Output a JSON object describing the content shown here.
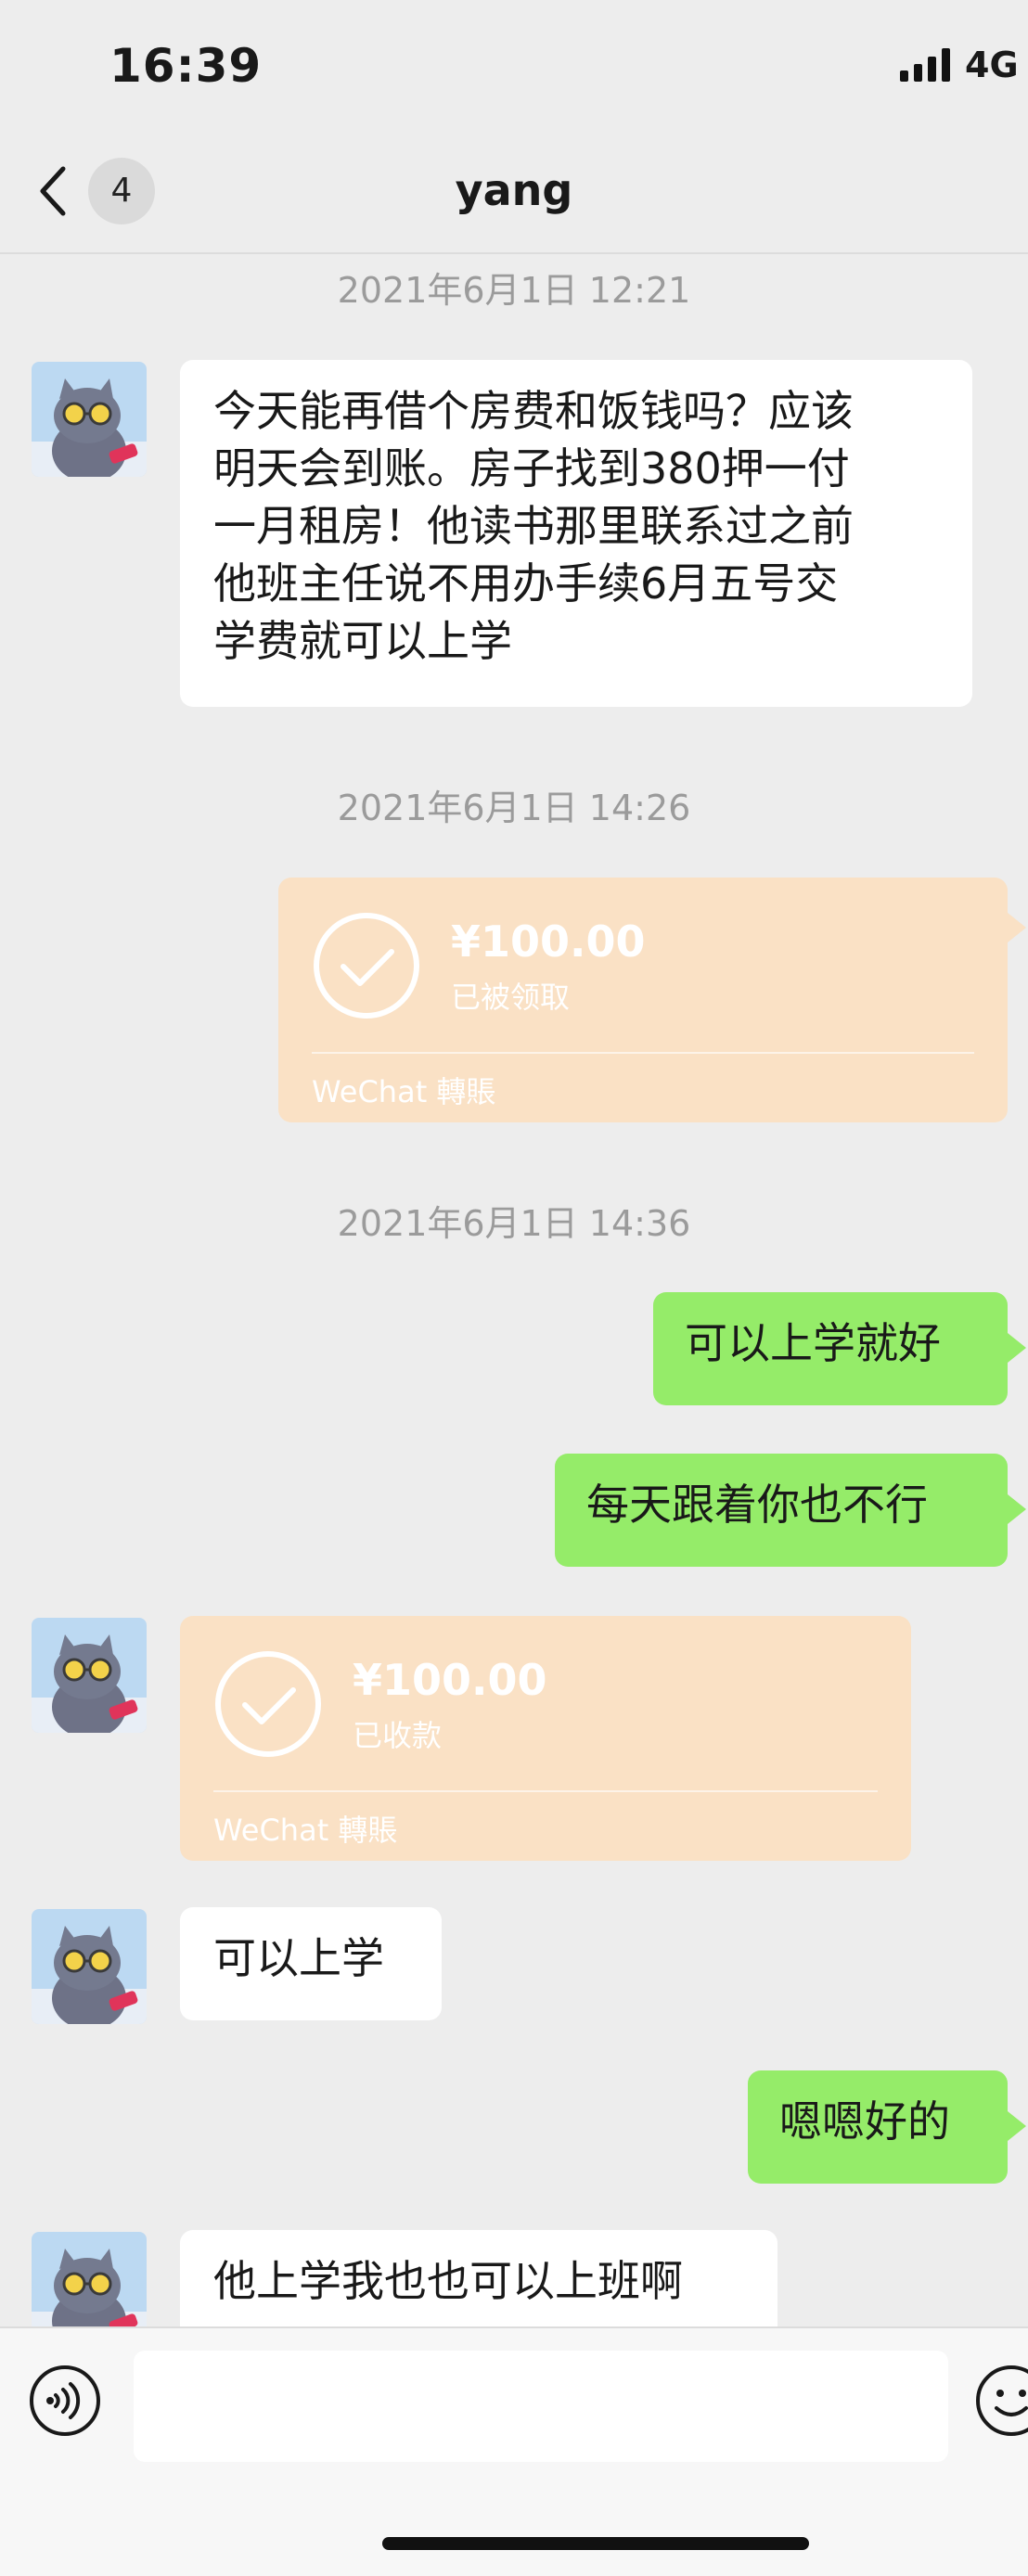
{
  "status_bar": {
    "time": "16:39",
    "network": "4G"
  },
  "nav": {
    "back_count": "4",
    "title": "yang"
  },
  "messages": [
    {
      "type": "timestamp",
      "text": "2021年6月1日 12:21"
    },
    {
      "type": "incoming_text",
      "lines": [
        "今天能再借个房费和饭钱吗？应该",
        "明天会到账。房子找到380押一付",
        "一月租房！他读书那里联系过之前",
        "他班主任说不用办手续6月五号交",
        "学费就可以上学"
      ]
    },
    {
      "type": "timestamp",
      "text": "2021年6月1日 14:26"
    },
    {
      "type": "outgoing_transfer",
      "amount": "¥100.00",
      "status": "已被领取",
      "label": "WeChat 轉賬"
    },
    {
      "type": "timestamp",
      "text": "2021年6月1日 14:36"
    },
    {
      "type": "outgoing_text",
      "text": "可以上学就好"
    },
    {
      "type": "outgoing_text",
      "text": "每天跟着你也不行"
    },
    {
      "type": "incoming_transfer",
      "amount": "¥100.00",
      "status": "已收款",
      "label": "WeChat 轉賬"
    },
    {
      "type": "incoming_text",
      "text": "可以上学"
    },
    {
      "type": "outgoing_text",
      "text": "嗯嗯好的"
    },
    {
      "type": "incoming_text",
      "text": "他上学我也也可以上班啊"
    }
  ],
  "input_bar": {
    "placeholder": "",
    "voice_icon": "voice-icon",
    "emoji_icon": "emoji-icon"
  },
  "colors": {
    "background": "#ededed",
    "outgoing_bubble": "#95ec69",
    "incoming_bubble": "#ffffff",
    "transfer_card": "#fae1c5"
  }
}
